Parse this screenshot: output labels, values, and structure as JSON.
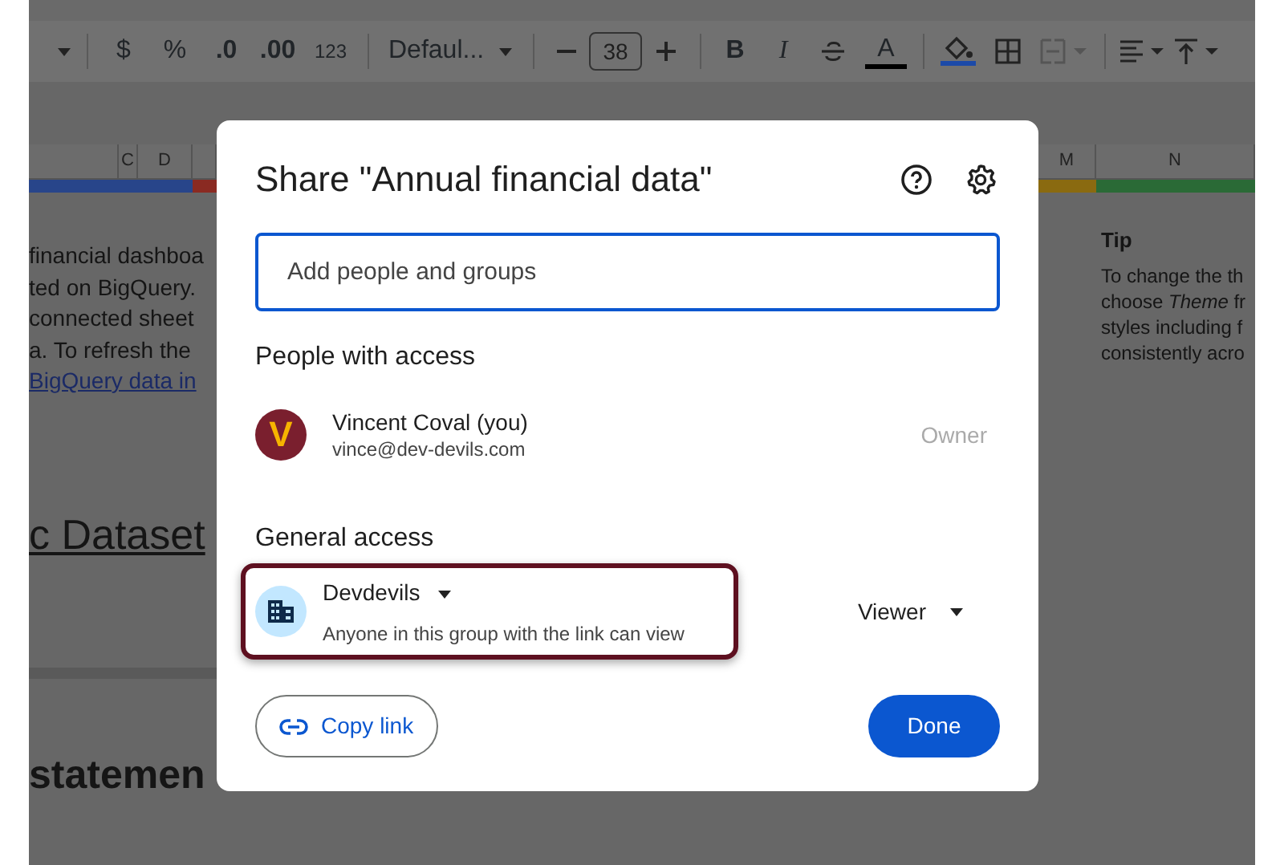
{
  "toolbar": {
    "currency": "$",
    "percent": "%",
    "decrease_decimal": ".0",
    "increase_decimal": ".00",
    "number_format": "123",
    "font": "Defaul...",
    "font_size": "38",
    "bold": "B",
    "italic": "I",
    "text_color": "A",
    "merge_disabled": true
  },
  "sheet": {
    "left_columns": [
      "C",
      "D"
    ],
    "right_columns": [
      "M",
      "N"
    ],
    "intro_lines": [
      "financial dashboa",
      "ted on BigQuery.",
      "connected sheet",
      "a. To refresh the"
    ],
    "link": "BigQuery data in",
    "dataset_heading": "c Dataset",
    "section_heading": "statemen",
    "tip": {
      "title": "Tip",
      "lines": [
        "To change the th",
        "choose *Theme* fr",
        "styles including f",
        "consistently acro"
      ]
    }
  },
  "dialog": {
    "title": "Share \"Annual financial data\"",
    "search": {
      "placeholder": "Add people and groups"
    },
    "people_heading": "People with access",
    "people": [
      {
        "name": "Vincent Coval (you)",
        "email": "vince@dev-devils.com",
        "role": "Owner",
        "avatar_letter": "V"
      }
    ],
    "general_heading": "General access",
    "general": {
      "group": "Devdevils",
      "description": "Anyone in this group with the link can view",
      "role": "Viewer",
      "highlighted": true
    },
    "copy_button": "Copy link",
    "done_button": "Done"
  }
}
